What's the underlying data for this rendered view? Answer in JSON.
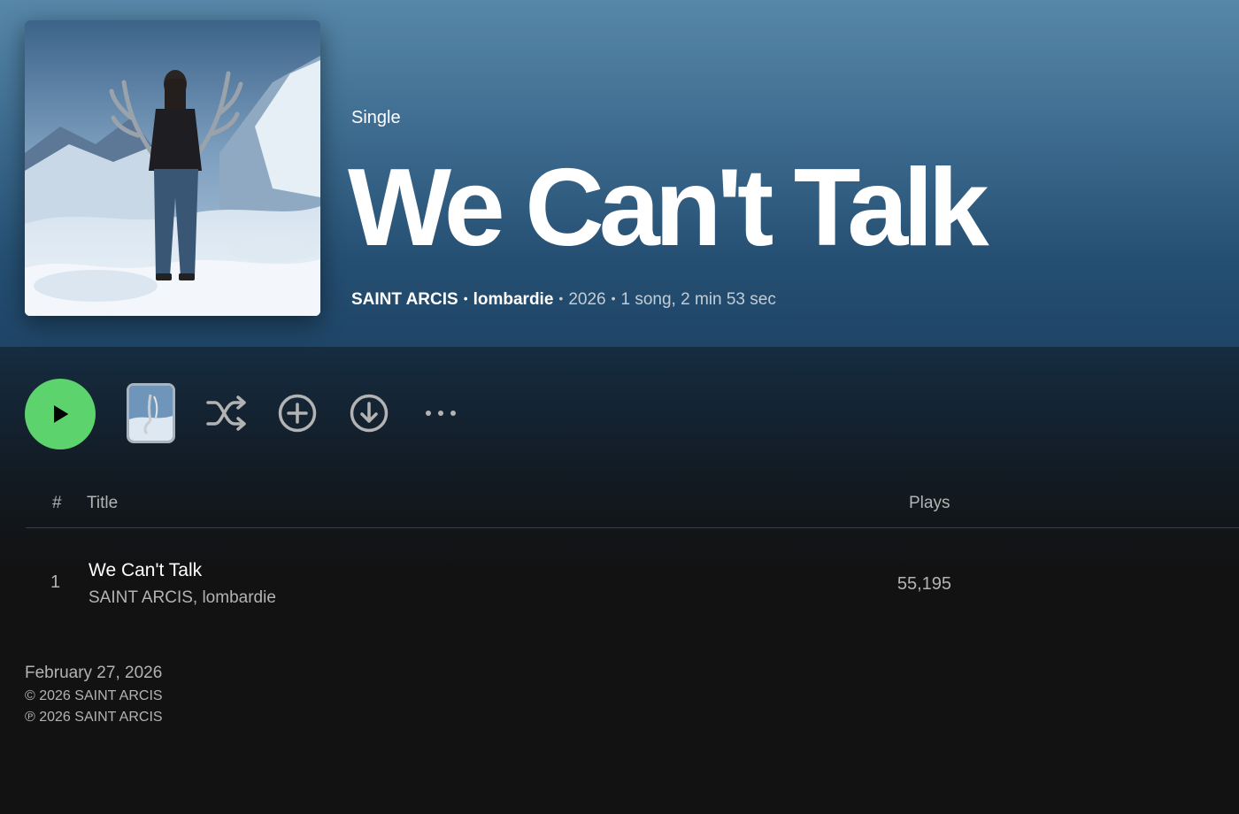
{
  "header": {
    "type_label": "Single",
    "title": "We Can't Talk",
    "artist_1": "SAINT ARCIS",
    "artist_2": "lombardie",
    "year": "2026",
    "summary": "1 song, 2 min 53 sec"
  },
  "actions": {
    "play_icon": "play-icon",
    "shuffle_icon": "shuffle-icon",
    "add_icon": "add-circle-icon",
    "download_icon": "download-icon",
    "more_icon": "more-options-icon"
  },
  "table": {
    "col_number": "#",
    "col_title": "Title",
    "col_plays": "Plays",
    "tracks": [
      {
        "number": "1",
        "title": "We Can't Talk",
        "artists": "SAINT ARCIS, lombardie",
        "plays": "55,195"
      }
    ]
  },
  "footer": {
    "release_date": "February 27, 2026",
    "copyright": "© 2026 SAINT ARCIS",
    "phonographic": "℗ 2026 SAINT ARCIS"
  },
  "colors": {
    "accent": "#5dd36e",
    "hero_top": "#5787a8",
    "hero_bottom": "#1f4567",
    "background": "#121212"
  }
}
